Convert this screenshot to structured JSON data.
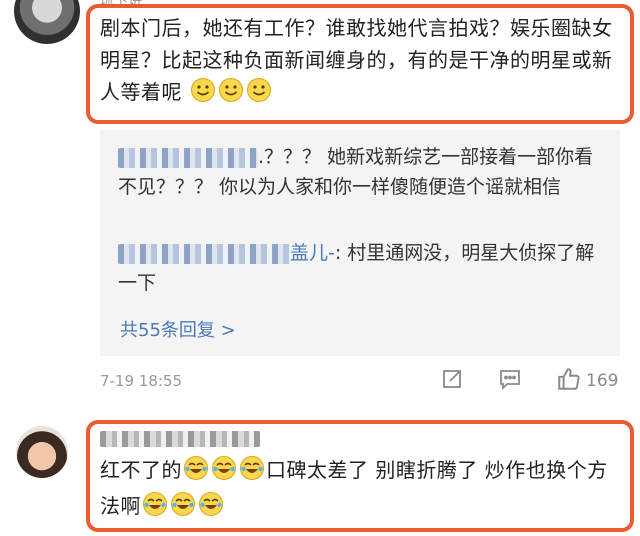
{
  "comment1": {
    "username": "琉卞讲",
    "text": "剧本门后，她还有工作？谁敢找她代言拍戏？娱乐圈缺女明星？比起这种负面新闻缠身的，有的是干净的明星或新人等着呢",
    "emojis": [
      "smile-icon",
      "smile-icon",
      "smile-icon"
    ]
  },
  "replies": [
    {
      "text": ".？？？ 她新戏新综艺一部接着一部你看不见？？？ 你以为人家和你一样傻随便造个谣就相信"
    },
    {
      "name": "盖儿-",
      "text": ": 村里通网没，明星大侦探了解一下"
    }
  ],
  "more_replies": "共55条回复 >",
  "comment1_meta": {
    "time": "7-19 18:55",
    "like_count": "169"
  },
  "comment2": {
    "text_a": "红不了的",
    "text_b": "口碑太差了 别瞎折腾了 炒作也换个方法啊"
  },
  "colors": {
    "accent": "#ee5a2f",
    "link": "#4a79b8",
    "muted": "#9a9a9a"
  }
}
